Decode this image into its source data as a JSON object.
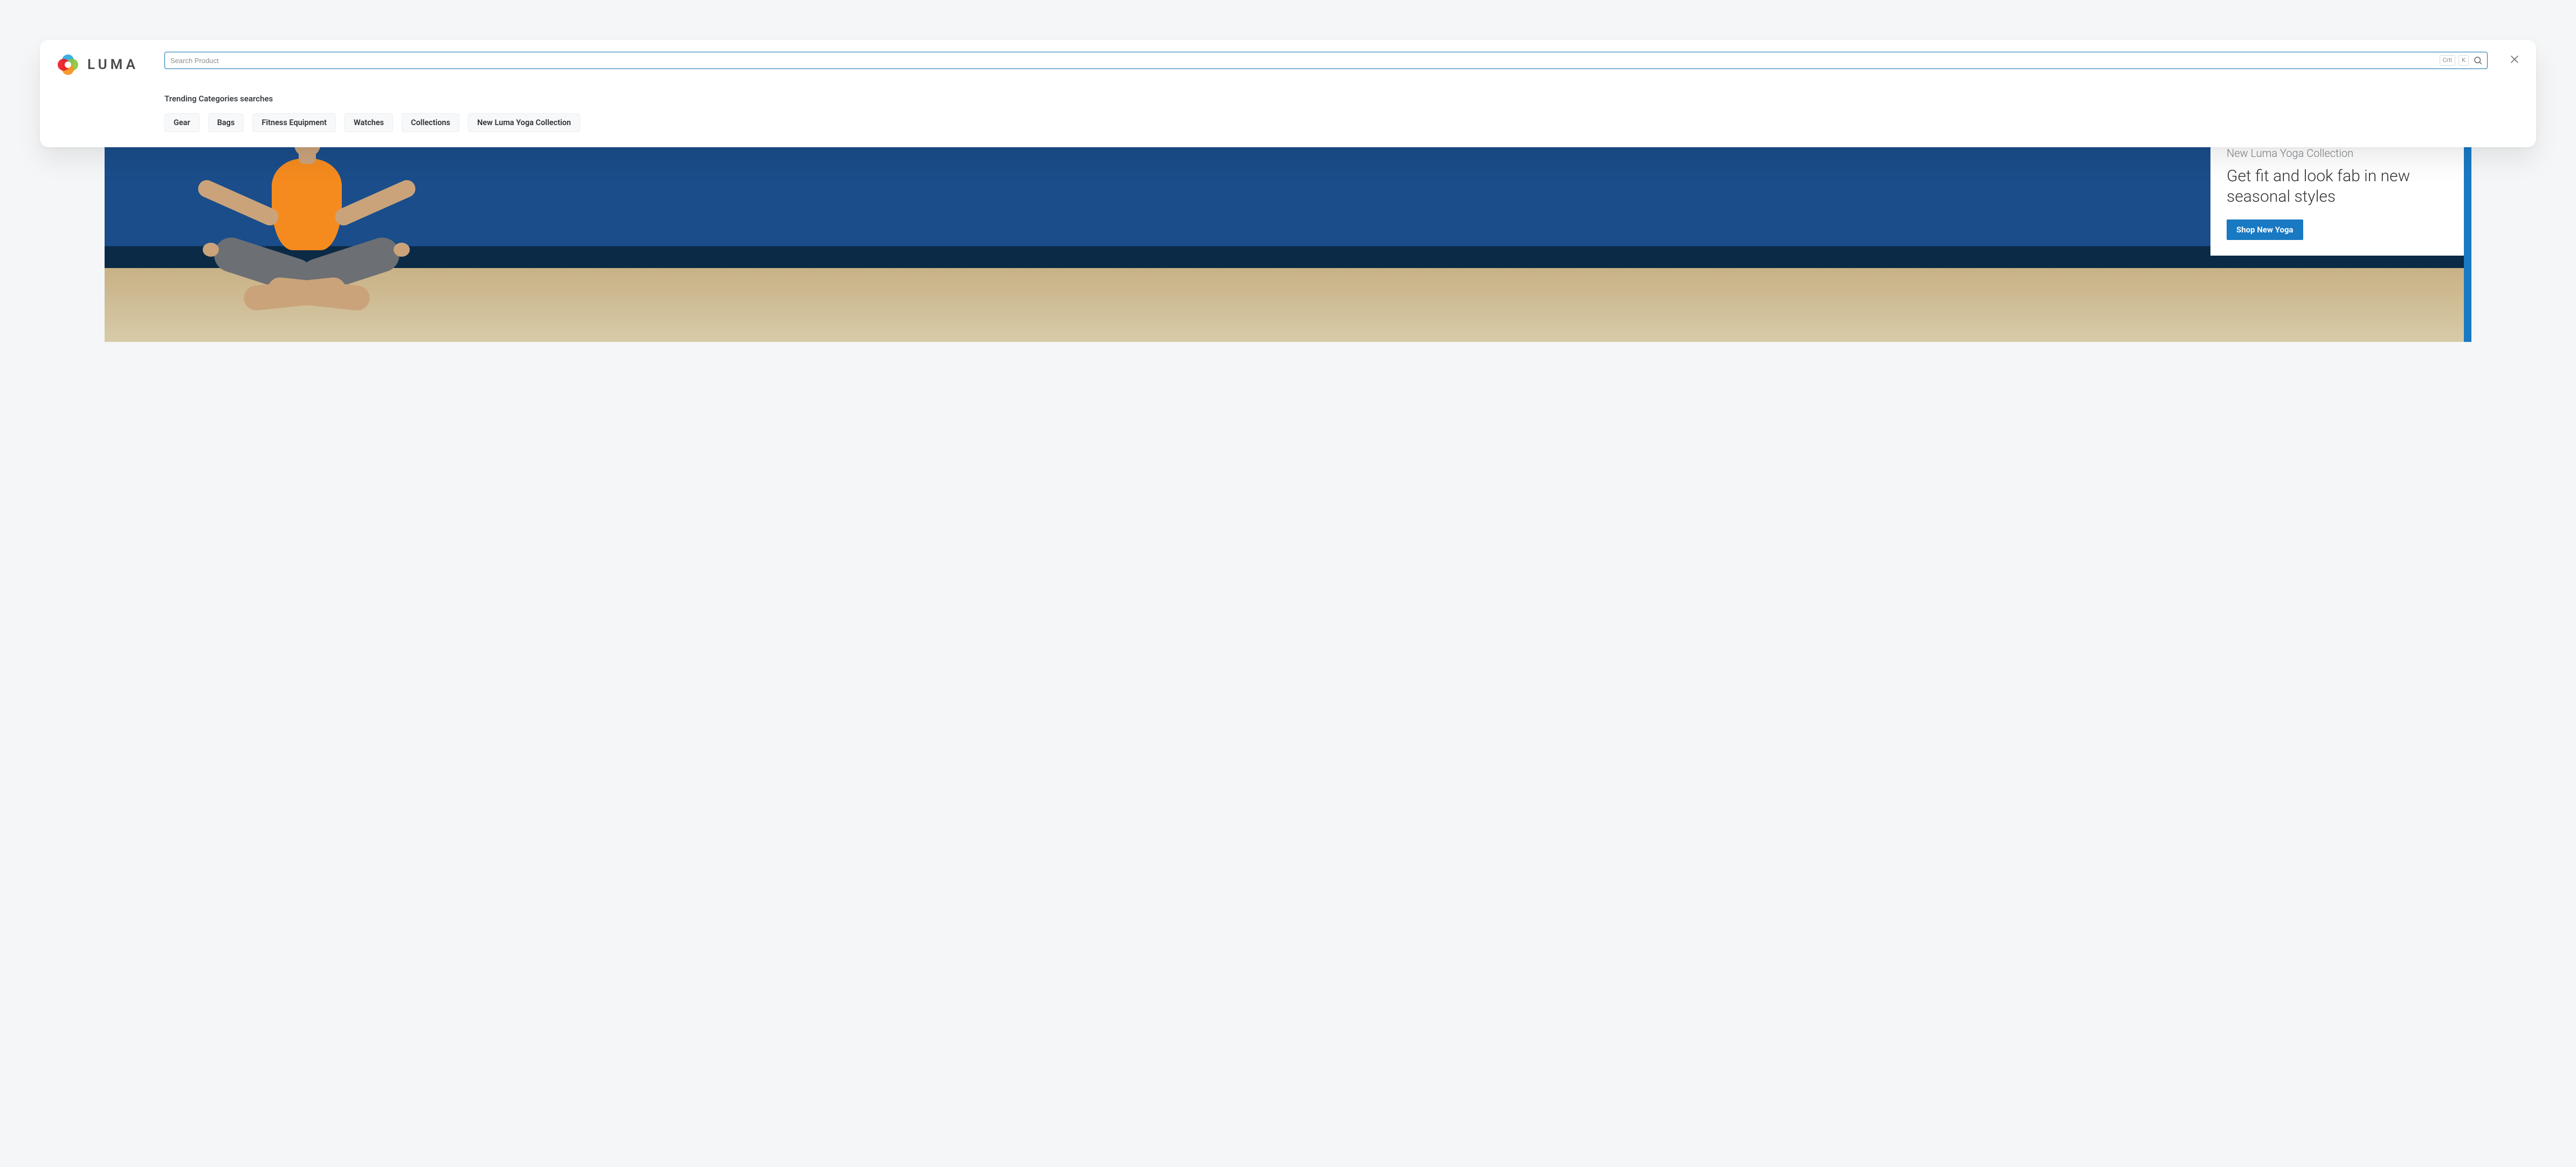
{
  "brand": {
    "name": "LUMA"
  },
  "search": {
    "placeholder": "Search Product",
    "shortcut_mod": "Crtl",
    "shortcut_key": "K"
  },
  "trending": {
    "title": "Trending Categories searches",
    "items": [
      "Gear",
      "Bags",
      "Fitness Equipment",
      "Watches",
      "Collections",
      "New Luma Yoga Collection"
    ]
  },
  "hero": {
    "eyebrow": "New Luma Yoga Collection",
    "headline": "Get fit and look fab in new seasonal styles",
    "cta": "Shop New Yoga"
  }
}
